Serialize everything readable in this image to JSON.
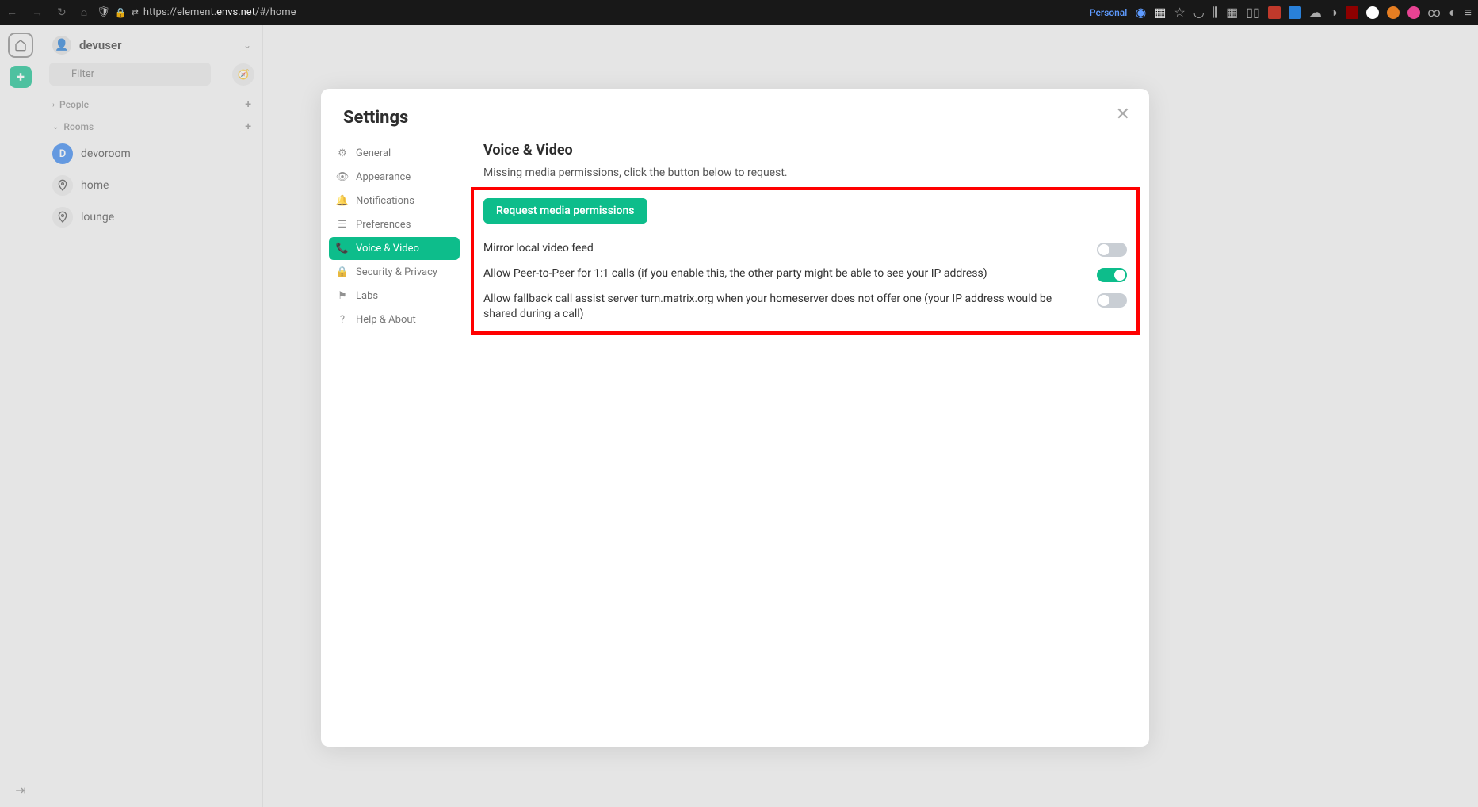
{
  "browser": {
    "url_prefix": "https://element.",
    "url_host": "envs.net",
    "url_path": "/#/home",
    "personal_label": "Personal"
  },
  "user": {
    "name": "devuser"
  },
  "filter": {
    "placeholder": "Filter"
  },
  "sections": {
    "people": "People",
    "rooms": "Rooms"
  },
  "rooms": [
    {
      "label": "devoroom",
      "avatar": "D",
      "kind": "letter"
    },
    {
      "label": "home",
      "kind": "pin"
    },
    {
      "label": "lounge",
      "kind": "pin"
    }
  ],
  "dialog": {
    "title": "Settings",
    "nav": [
      {
        "icon": "gear",
        "label": "General"
      },
      {
        "icon": "eye",
        "label": "Appearance"
      },
      {
        "icon": "bell",
        "label": "Notifications"
      },
      {
        "icon": "sliders",
        "label": "Preferences"
      },
      {
        "icon": "phone",
        "label": "Voice & Video",
        "active": true
      },
      {
        "icon": "lock",
        "label": "Security & Privacy"
      },
      {
        "icon": "flag",
        "label": "Labs"
      },
      {
        "icon": "help",
        "label": "Help & About"
      }
    ],
    "voice_video": {
      "heading": "Voice & Video",
      "missing_text": "Missing media permissions, click the button below to request.",
      "request_button": "Request media permissions",
      "toggles": [
        {
          "label": "Mirror local video feed",
          "on": false
        },
        {
          "label": "Allow Peer-to-Peer for 1:1 calls (if you enable this, the other party might be able to see your IP address)",
          "on": true
        },
        {
          "label": "Allow fallback call assist server turn.matrix.org when your homeserver does not offer one (your IP address would be shared during a call)",
          "on": false
        }
      ]
    }
  }
}
